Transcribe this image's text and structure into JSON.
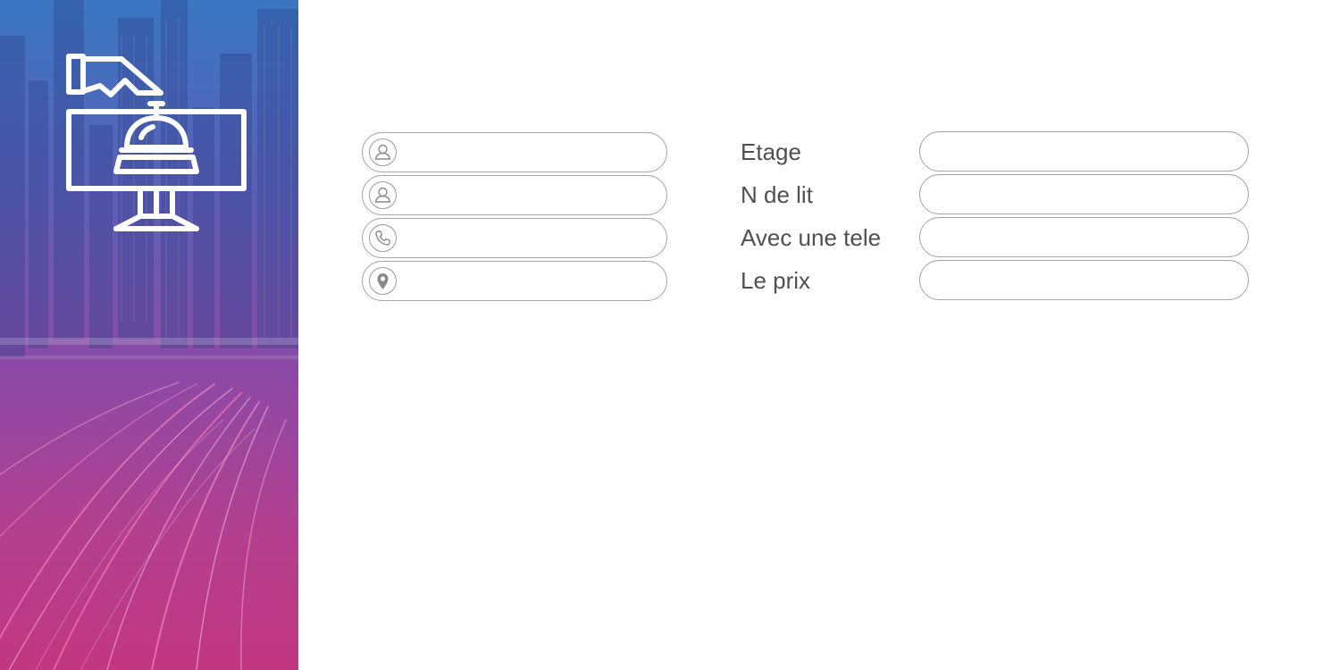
{
  "sidebar": {
    "logo_icon": "hotel-reception-bell-icon",
    "accent_colors": [
      "#3a77c2",
      "#8b4aa6",
      "#c2377f"
    ]
  },
  "form_left": {
    "fields": [
      {
        "icon": "user-icon",
        "value": "",
        "placeholder": ""
      },
      {
        "icon": "user-icon",
        "value": "",
        "placeholder": ""
      },
      {
        "icon": "phone-icon",
        "value": "",
        "placeholder": ""
      },
      {
        "icon": "location-pin-icon",
        "value": "",
        "placeholder": ""
      }
    ]
  },
  "form_right": {
    "fields": [
      {
        "label": "Etage",
        "value": ""
      },
      {
        "label": "N de lit",
        "value": ""
      },
      {
        "label": "Avec une tele",
        "value": ""
      },
      {
        "label": "Le prix",
        "value": ""
      }
    ]
  }
}
